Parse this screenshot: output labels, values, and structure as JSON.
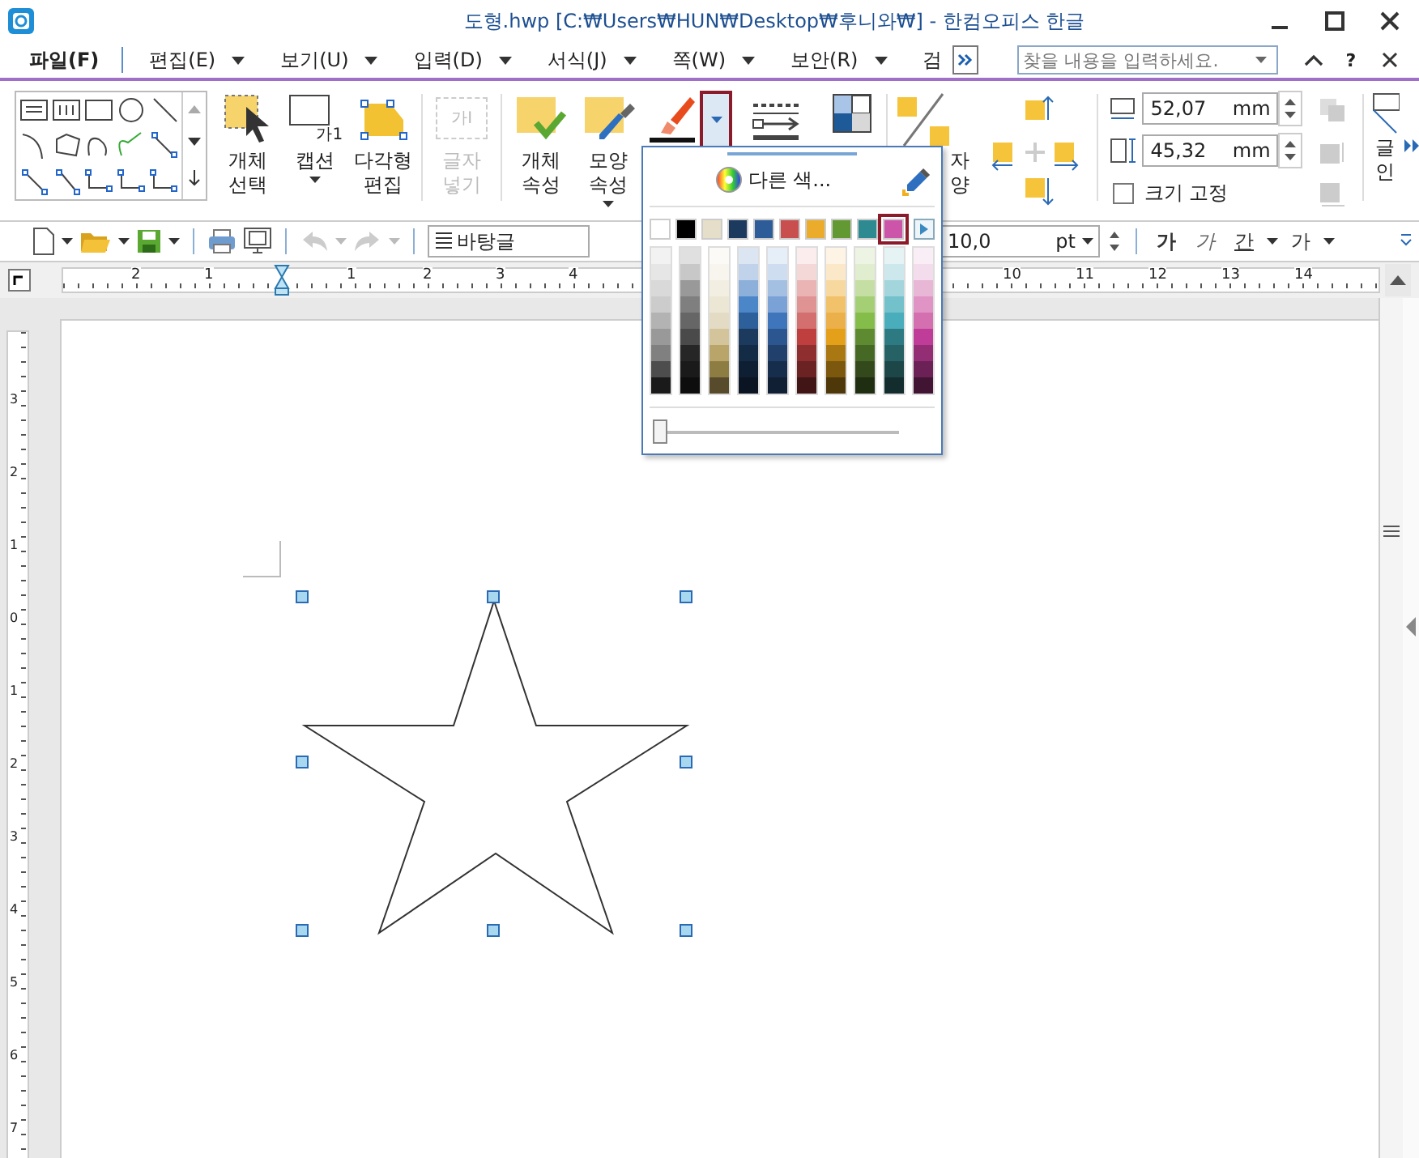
{
  "window": {
    "title": "도형.hwp [C:₩Users₩HUN₩Desktop₩후니와₩] - 한컴오피스 한글"
  },
  "menu": [
    {
      "label": "파일(F)",
      "selected": true
    },
    {
      "label": "편집(E)",
      "selected": false
    },
    {
      "label": "보기(U)",
      "selected": false
    },
    {
      "label": "입력(D)",
      "selected": false
    },
    {
      "label": "서식(J)",
      "selected": false
    },
    {
      "label": "쪽(W)",
      "selected": false
    },
    {
      "label": "보안(R)",
      "selected": false
    },
    {
      "label": "검",
      "selected": false
    }
  ],
  "search": {
    "placeholder": "찾을 내용을 입력하세요."
  },
  "help_label": "?",
  "ribbon": {
    "buttons": [
      {
        "kind": "select",
        "label": "개체\n선택",
        "disabled": false,
        "has_menu": false
      },
      {
        "kind": "caption",
        "label": "캡션",
        "icon_text": "가1",
        "disabled": false,
        "has_menu": true
      },
      {
        "kind": "polygon",
        "label": "다각형\n편집",
        "disabled": false,
        "has_menu": false
      },
      {
        "kind": "textbox",
        "label": "글자\n넣기",
        "icon_text": "가I",
        "disabled": true,
        "has_menu": false
      },
      {
        "kind": "props",
        "label": "개체\n속성",
        "disabled": false,
        "has_menu": false
      },
      {
        "kind": "shape",
        "label": "모양\n속성",
        "disabled": false,
        "has_menu": true
      }
    ],
    "line_color_dropdown": {
      "expanded": true
    },
    "partial_label": "자\n양",
    "width": {
      "value": "52,07",
      "unit": "mm"
    },
    "height": {
      "value": "45,32",
      "unit": "mm"
    },
    "lock_size": {
      "label": "크기 고정",
      "checked": false
    },
    "cut_label": "글\n인"
  },
  "toolbar": {
    "style": "바탕글",
    "font_size": "10,0",
    "size_unit": "pt",
    "format": [
      {
        "label": "가",
        "kind": "bold"
      },
      {
        "label": "가",
        "kind": "italic"
      },
      {
        "label": "간",
        "kind": "underline"
      },
      {
        "label": "가",
        "kind": "strike"
      }
    ]
  },
  "ruler": {
    "labels": [
      "2",
      "1",
      "1",
      "2",
      "3",
      "4",
      "10",
      "11",
      "12",
      "13",
      "14"
    ]
  },
  "vruler": {
    "labels": [
      "3",
      "2",
      "1",
      "0",
      "1",
      "2",
      "3",
      "4",
      "5",
      "6",
      "7"
    ]
  },
  "palette": {
    "more_colors": "다른 색...",
    "swatches": [
      {
        "color": "#ffffff",
        "selected": false
      },
      {
        "color": "#000000",
        "selected": false
      },
      {
        "color": "#e5dec8",
        "selected": false
      },
      {
        "color": "#1b3a5e",
        "selected": false
      },
      {
        "color": "#2e5c98",
        "selected": false
      },
      {
        "color": "#c94f4f",
        "selected": false
      },
      {
        "color": "#ecac2b",
        "selected": false
      },
      {
        "color": "#639932",
        "selected": false
      },
      {
        "color": "#2e8a91",
        "selected": false
      },
      {
        "color": "#cc55aa",
        "selected": true
      }
    ],
    "shades": [
      {
        "colors": [
          {
            "color": "#f2f2f2"
          },
          {
            "color": "#e6e6e6"
          },
          {
            "color": "#d9d9d9"
          },
          {
            "color": "#cccccc"
          },
          {
            "color": "#b3b3b3"
          },
          {
            "color": "#999999"
          },
          {
            "color": "#808080"
          },
          {
            "color": "#4d4d4d"
          },
          {
            "color": "#1a1a1a"
          }
        ]
      },
      {
        "colors": [
          {
            "color": "#e0e0e0"
          },
          {
            "color": "#c8c8c8"
          },
          {
            "color": "#999999"
          },
          {
            "color": "#7f7f7f"
          },
          {
            "color": "#666666"
          },
          {
            "color": "#4a4a4a"
          },
          {
            "color": "#262626"
          },
          {
            "color": "#1a1a1a"
          },
          {
            "color": "#0d0d0d"
          }
        ]
      },
      {
        "colors": [
          {
            "color": "#fbfaf6"
          },
          {
            "color": "#f7f5ee"
          },
          {
            "color": "#f2efe2"
          },
          {
            "color": "#ece7d5"
          },
          {
            "color": "#e3dbc3"
          },
          {
            "color": "#d3c49c"
          },
          {
            "color": "#b9a46a"
          },
          {
            "color": "#8e7d42"
          },
          {
            "color": "#574b2b"
          }
        ]
      },
      {
        "colors": [
          {
            "color": "#dce6f2"
          },
          {
            "color": "#c1d3ea"
          },
          {
            "color": "#8db0da"
          },
          {
            "color": "#4a86c8"
          },
          {
            "color": "#2d5f9a"
          },
          {
            "color": "#1c3a5e"
          },
          {
            "color": "#142b46"
          },
          {
            "color": "#0f1f33"
          },
          {
            "color": "#0a1422"
          }
        ]
      },
      {
        "colors": [
          {
            "color": "#e6eef8"
          },
          {
            "color": "#cedef0"
          },
          {
            "color": "#a3c0e3"
          },
          {
            "color": "#7aa2d6"
          },
          {
            "color": "#3f76bb"
          },
          {
            "color": "#2c5690"
          },
          {
            "color": "#21406b"
          },
          {
            "color": "#172d4c"
          },
          {
            "color": "#101f34"
          }
        ]
      },
      {
        "colors": [
          {
            "color": "#fbeded"
          },
          {
            "color": "#f4d7d7"
          },
          {
            "color": "#eab4b4"
          },
          {
            "color": "#df9393"
          },
          {
            "color": "#d36f6f"
          },
          {
            "color": "#bf3f3f"
          },
          {
            "color": "#8f2e2e"
          },
          {
            "color": "#6a2222"
          },
          {
            "color": "#411515"
          }
        ]
      },
      {
        "colors": [
          {
            "color": "#fdf4e5"
          },
          {
            "color": "#fbe8c8"
          },
          {
            "color": "#f7d9a0"
          },
          {
            "color": "#f1c26a"
          },
          {
            "color": "#ecb04a"
          },
          {
            "color": "#e3a018"
          },
          {
            "color": "#aa7813"
          },
          {
            "color": "#7c570e"
          },
          {
            "color": "#4e3709"
          }
        ]
      },
      {
        "colors": [
          {
            "color": "#eef4e4"
          },
          {
            "color": "#e0edcf"
          },
          {
            "color": "#c4dea3"
          },
          {
            "color": "#a4cf75"
          },
          {
            "color": "#85bd4a"
          },
          {
            "color": "#5e8a31"
          },
          {
            "color": "#466825"
          },
          {
            "color": "#33491b"
          },
          {
            "color": "#1f2d10"
          }
        ]
      },
      {
        "colors": [
          {
            "color": "#e5f3f5"
          },
          {
            "color": "#cce8ec"
          },
          {
            "color": "#a3d5dc"
          },
          {
            "color": "#72c1cb"
          },
          {
            "color": "#49adbb"
          },
          {
            "color": "#2e7a83"
          },
          {
            "color": "#266166"
          },
          {
            "color": "#1d4648"
          },
          {
            "color": "#132d2f"
          }
        ]
      },
      {
        "colors": [
          {
            "color": "#f9eef5"
          },
          {
            "color": "#f3dceb"
          },
          {
            "color": "#e9b7d6"
          },
          {
            "color": "#e093c5"
          },
          {
            "color": "#d46fb0"
          },
          {
            "color": "#c03c99"
          },
          {
            "color": "#932e75"
          },
          {
            "color": "#6c2156"
          },
          {
            "color": "#411433"
          }
        ]
      }
    ],
    "transparency": {
      "level": 0
    }
  }
}
